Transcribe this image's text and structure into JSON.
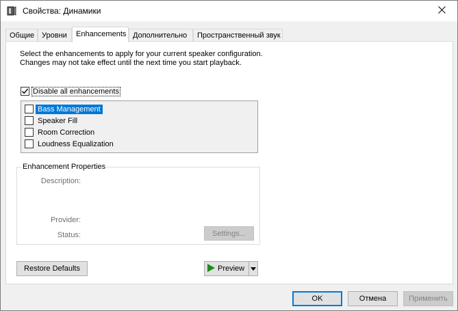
{
  "window": {
    "title": "Свойства: Динамики"
  },
  "tabs": [
    {
      "label": "Общие"
    },
    {
      "label": "Уровни"
    },
    {
      "label": "Enhancements"
    },
    {
      "label": "Дополнительно"
    },
    {
      "label": "Пространственный звук"
    }
  ],
  "enhancements": {
    "description": "Select the enhancements to apply for your current speaker configuration. Changes may not take effect until the next time you start playback.",
    "disable_all": {
      "label": "Disable all enhancements",
      "checked": true
    },
    "items": [
      {
        "label": "Bass Management",
        "checked": false,
        "selected": true
      },
      {
        "label": "Speaker Fill",
        "checked": false,
        "selected": false
      },
      {
        "label": "Room Correction",
        "checked": false,
        "selected": false
      },
      {
        "label": "Loudness Equalization",
        "checked": false,
        "selected": false
      }
    ]
  },
  "properties": {
    "group_title": "Enhancement Properties",
    "description_label": "Description:",
    "provider_label": "Provider:",
    "status_label": "Status:",
    "settings_button": "Settings..."
  },
  "buttons": {
    "restore_defaults": "Restore Defaults",
    "preview": "Preview",
    "ok": "OK",
    "cancel": "Отмена",
    "apply": "Применить"
  },
  "colors": {
    "selection": "#0078d7",
    "play_icon": "#1e8c1e"
  }
}
